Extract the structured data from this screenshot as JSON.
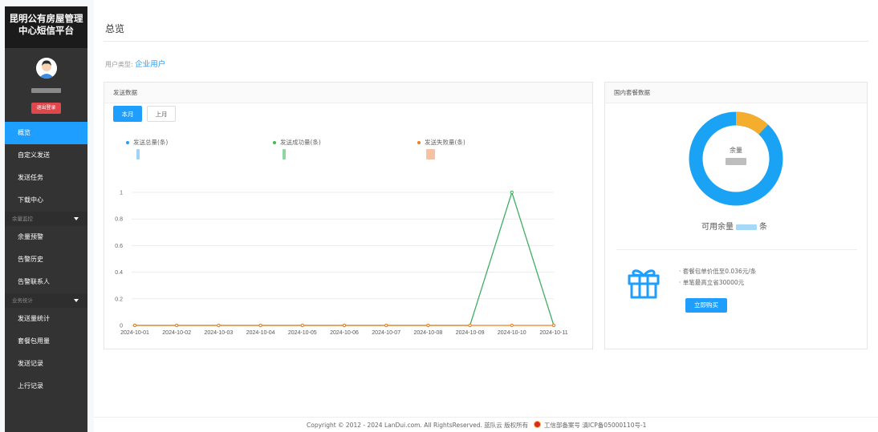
{
  "sidebar": {
    "brand_line1": "昆明公有房屋管理",
    "brand_line2": "中心短信平台",
    "logout_label": "退出登录",
    "items": [
      {
        "label": "概览",
        "active": true
      },
      {
        "label": "自定义发送"
      },
      {
        "label": "发送任务"
      },
      {
        "label": "下载中心"
      }
    ],
    "group_balance": "余量监控",
    "balance_items": [
      {
        "label": "余量预警"
      },
      {
        "label": "告警历史"
      },
      {
        "label": "告警联系人"
      }
    ],
    "group_stats": "业务统计",
    "stats_items": [
      {
        "label": "发送量统计"
      },
      {
        "label": "套餐包用量"
      },
      {
        "label": "发送记录"
      },
      {
        "label": "上行记录"
      }
    ]
  },
  "header": {
    "title": "总览",
    "user_type_label": "用户类型:",
    "user_type_value": "企业用户"
  },
  "send_card": {
    "title": "发送数据",
    "tab_this_month": "本月",
    "tab_last_month": "上月",
    "legend": [
      {
        "name": "发送总量(条)",
        "color": "#1e9fff"
      },
      {
        "name": "发送成功量(条)",
        "color": "#3fb950"
      },
      {
        "name": "发送失败量(条)",
        "color": "#f07d1f"
      }
    ]
  },
  "chart_data": {
    "type": "line",
    "x": [
      "2024-10-01",
      "2024-10-02",
      "2024-10-03",
      "2024-10-04",
      "2024-10-05",
      "2024-10-06",
      "2024-10-07",
      "2024-10-08",
      "2024-10-09",
      "2024-10-10",
      "2024-10-11"
    ],
    "series": [
      {
        "name": "发送成功量(条)",
        "color": "#3fae62",
        "values": [
          0,
          0,
          0,
          0,
          0,
          0,
          0,
          0,
          0,
          1,
          0
        ]
      },
      {
        "name": "发送失败量(条)",
        "color": "#f07d1f",
        "values": [
          0,
          0,
          0,
          0,
          0,
          0,
          0,
          0,
          0,
          0,
          0
        ]
      }
    ],
    "y_ticks": [
      "0",
      "0.2",
      "0.4",
      "0.6",
      "0.8",
      "1"
    ],
    "ylim": [
      0,
      1
    ],
    "grid": true
  },
  "package_card": {
    "title": "国内套餐数据",
    "donut_label": "余量",
    "donut_used_fraction": 0.12,
    "donut_colors": {
      "remaining": "#1aa3f5",
      "used": "#f5ad2e"
    },
    "available_prefix": "可用余量",
    "available_suffix": "条",
    "line1": "· 套餐包单价低至0.036元/条",
    "line2": "· 单笔最高立省30000元",
    "buy_label": "立即购买"
  },
  "footer": {
    "copyright": "Copyright © 2012 - 2024 LanDui.com. All RightsReserved. 蓝队云 版权所有",
    "icp": "工信部备案号 滇ICP备05000110号-1"
  }
}
